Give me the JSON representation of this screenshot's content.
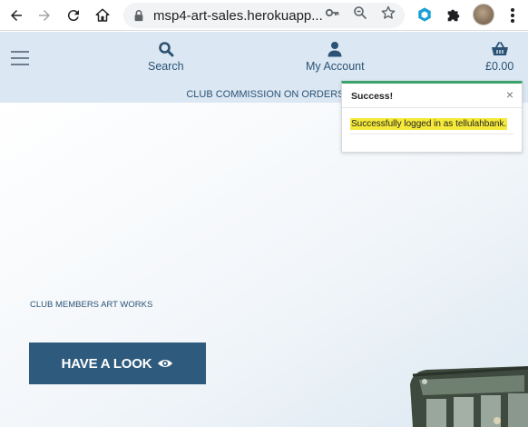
{
  "browser": {
    "url": "msp4-art-sales.herokuapp...",
    "icons": [
      "back-icon",
      "forward-icon",
      "reload-icon",
      "home-icon",
      "lock-icon",
      "key-icon",
      "zoom-icon",
      "star-icon",
      "extension-cube-icon",
      "puzzle-icon",
      "profile-avatar",
      "menu-kebab-icon"
    ]
  },
  "header": {
    "search_label": "Search",
    "account_label": "My Account",
    "cart_total": "£0.00",
    "banner": "CLUB COMMISSION ON ORDERS 5"
  },
  "hero": {
    "subtitle": "CLUB MEMBERS ART WORKS",
    "cta_label": "HAVE A LOOK"
  },
  "toast": {
    "title": "Success!",
    "close": "×",
    "message": "Successfully logged in as tellulahbank."
  },
  "colors": {
    "header_bg": "#dbe7f2",
    "brand_blue": "#2e5a7e",
    "toast_accent": "#3aa36b",
    "highlight": "#f5ea3a"
  }
}
